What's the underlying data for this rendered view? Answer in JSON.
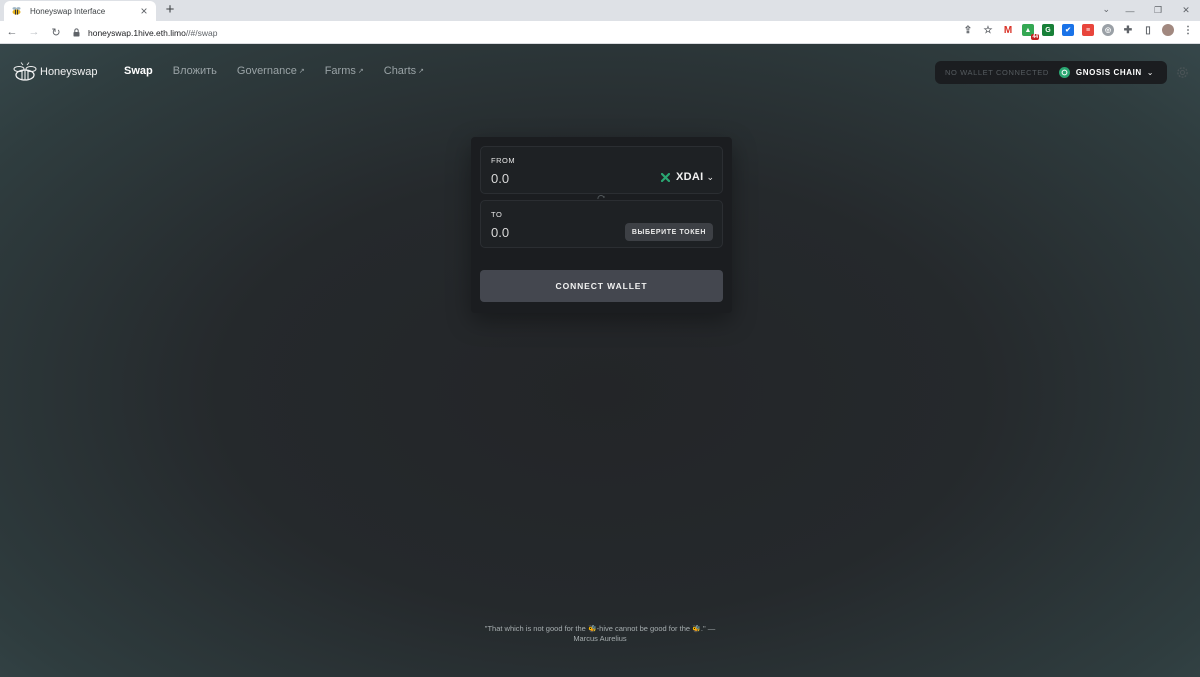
{
  "browser": {
    "tab_title": "Honeyswap Interface",
    "url_host": "honeyswap.1hive.eth.limo",
    "url_path": "//#/swap",
    "extension_badge": "44"
  },
  "header": {
    "brand": "Honeyswap",
    "nav": {
      "swap": "Swap",
      "pool": "Вложить",
      "governance": "Governance",
      "farms": "Farms",
      "charts": "Charts",
      "external_arrow": "↗"
    },
    "wallet_status": "NO WALLET CONNECTED",
    "chain_label": "GNOSIS CHAIN"
  },
  "swap": {
    "from_label": "FROM",
    "from_placeholder": "0.0",
    "from_token": "XDAI",
    "to_label": "TO",
    "to_placeholder": "0.0",
    "select_token_label": "ВЫБЕРИТЕ ТОКЕН",
    "connect_label": "CONNECT WALLET"
  },
  "footer": {
    "quote_part1": "\"That which is not good for the",
    "quote_part2": "-hive cannot be good for the",
    "quote_part3": ".\" —",
    "quote_author": "Marcus Aurelius"
  },
  "colors": {
    "accent_green": "#2aa772",
    "card_bg": "#1b1d20",
    "button_bg": "#44474f"
  }
}
